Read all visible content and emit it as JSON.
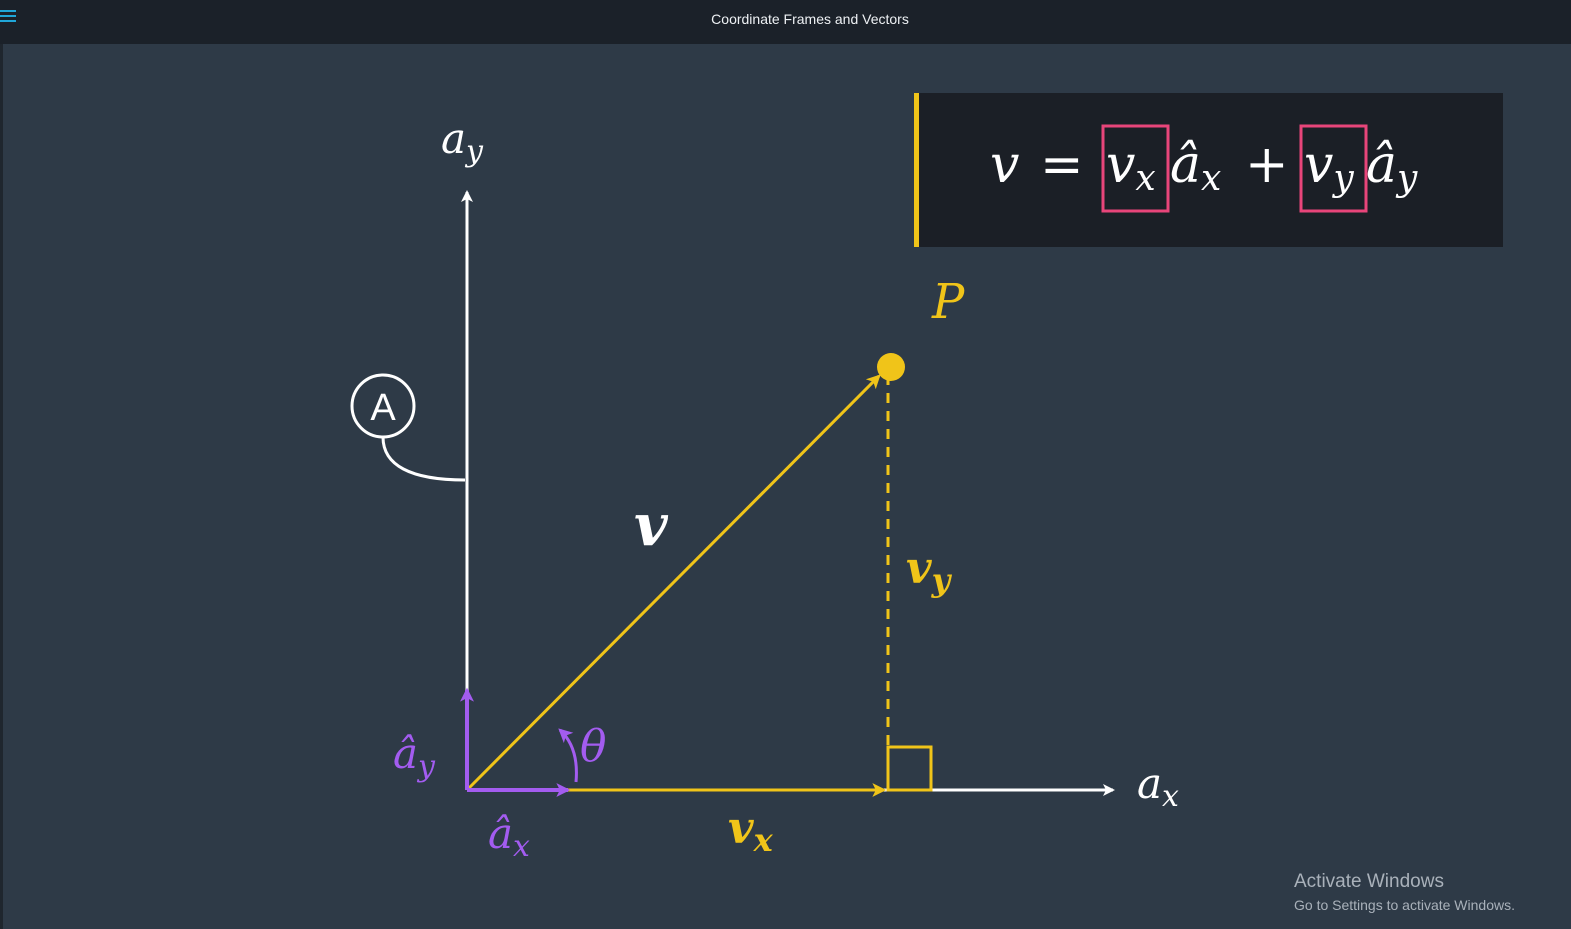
{
  "window": {
    "title": "Coordinate Frames and Vectors",
    "menu_icon": "hamburger-menu-icon"
  },
  "diagram": {
    "axis_y_label_base": "a",
    "axis_y_label_sub": "y",
    "axis_x_label_base": "a",
    "axis_x_label_sub": "x",
    "frame_label": "A",
    "vector_label": "v",
    "point_label": "P",
    "component_x_base": "v",
    "component_x_sub": "x",
    "component_y_base": "v",
    "component_y_sub": "y",
    "unit_x_base": "â",
    "unit_x_sub": "x",
    "unit_y_base": "â",
    "unit_y_sub": "y",
    "angle_label": "θ"
  },
  "equation": {
    "lhs": "v",
    "equals": "=",
    "term1_coef_base": "v",
    "term1_coef_sub": "x",
    "term1_unit_base": "â",
    "term1_unit_sub": "x",
    "plus": "+",
    "term2_coef_base": "v",
    "term2_coef_sub": "y",
    "term2_unit_base": "â",
    "term2_unit_sub": "y"
  },
  "colors": {
    "background": "#2e3a47",
    "axis": "#ffffff",
    "vector": "#f0c419",
    "unit_vectors": "#a35cf0",
    "highlight_box": "#e8457a",
    "equation_bar": "#f0c419",
    "equation_panel": "#1b1f26"
  },
  "os_watermark": {
    "line1": "Activate Windows",
    "line2": "Go to Settings to activate Windows."
  }
}
